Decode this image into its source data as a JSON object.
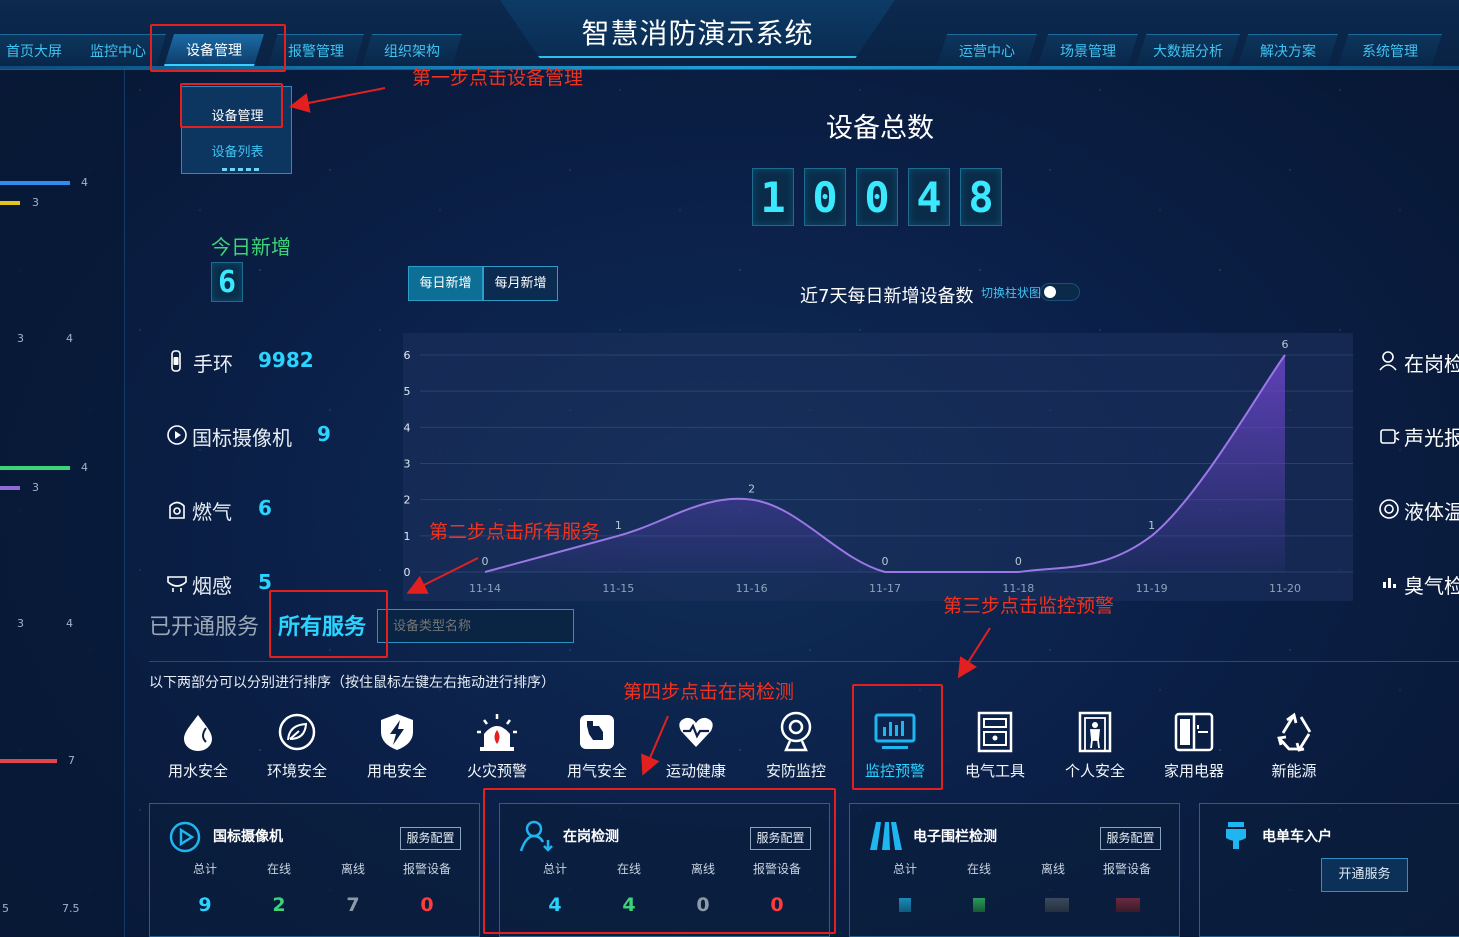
{
  "header": {
    "title": "智慧消防演示系统",
    "nav_left": [
      "首页大屏",
      "监控中心",
      "设备管理",
      "报警管理",
      "组织架构"
    ],
    "nav_right": [
      "运营中心",
      "场景管理",
      "大数据分析",
      "解决方案",
      "系统管理"
    ],
    "active": "设备管理"
  },
  "dropdown": {
    "items": [
      "设备管理",
      "设备列表"
    ]
  },
  "left_rail": {
    "nums": [
      "4",
      "3",
      "3",
      "4",
      "4",
      "3",
      "3",
      "4",
      "7",
      "5",
      "7.5"
    ],
    "bars": [
      {
        "color": "#2f8df2",
        "value": 4
      },
      {
        "color": "#e6c21c",
        "value": 3
      },
      {
        "color": "#3ed27a",
        "value": 4
      },
      {
        "color": "#8f6ad8",
        "value": 3
      },
      {
        "color": "#e0474d",
        "value": 7
      }
    ]
  },
  "summary": {
    "total_label": "设备总数",
    "total_digits": [
      "1",
      "0",
      "0",
      "4",
      "8"
    ],
    "today_label": "今日新增",
    "today_value": "6"
  },
  "devices": [
    {
      "label": "手环",
      "value": "9982"
    },
    {
      "label": "国标摄像机",
      "value": "9"
    },
    {
      "label": "燃气",
      "value": "6"
    },
    {
      "label": "烟感",
      "value": "5"
    }
  ],
  "chart_tabs": {
    "daily": "每日新增",
    "monthly": "每月新增"
  },
  "chart_title": "近7天每日新增设备数",
  "toggle_label": "切换柱状图",
  "chart_data": {
    "type": "area",
    "categories": [
      "11-14",
      "11-15",
      "11-16",
      "11-17",
      "11-18",
      "11-19",
      "11-20"
    ],
    "values": [
      0,
      1,
      2,
      0,
      0,
      1,
      6
    ],
    "ylim": [
      0,
      6
    ],
    "yticks": [
      0,
      1,
      2,
      3,
      4,
      5,
      6
    ],
    "title": "近7天每日新增设备数",
    "xlabel": "",
    "ylabel": "",
    "color": "#8f6ad8"
  },
  "right_labels": [
    "在岗检",
    "声光报",
    "液体温",
    "臭气检"
  ],
  "services": {
    "opened_tab": "已开通服务",
    "all_tab": "所有服务",
    "search_placeholder": "设备类型名称",
    "hint": "以下两部分可以分别进行排序（按住鼠标左键左右拖动进行排序）",
    "categories": [
      {
        "label": "用水安全",
        "icon": "water-drop-icon"
      },
      {
        "label": "环境安全",
        "icon": "leaf-icon"
      },
      {
        "label": "用电安全",
        "icon": "lightning-shield-icon"
      },
      {
        "label": "火灾预警",
        "icon": "alarm-siren-icon"
      },
      {
        "label": "用气安全",
        "icon": "gas-icon"
      },
      {
        "label": "运动健康",
        "icon": "heart-pulse-icon"
      },
      {
        "label": "安防监控",
        "icon": "webcam-icon"
      },
      {
        "label": "监控预警",
        "icon": "monitor-chart-icon"
      },
      {
        "label": "电气工具",
        "icon": "cabinet-icon"
      },
      {
        "label": "个人安全",
        "icon": "person-gate-icon"
      },
      {
        "label": "家用电器",
        "icon": "fridge-icon"
      },
      {
        "label": "新能源",
        "icon": "recycle-icon"
      }
    ]
  },
  "cards": [
    {
      "title": "国标摄像机",
      "config": "服务配置",
      "cols": [
        "总计",
        "在线",
        "离线",
        "报警设备"
      ],
      "values": [
        "9",
        "2",
        "7",
        "0"
      ],
      "icon": "play-circle-icon"
    },
    {
      "title": "在岗检测",
      "config": "服务配置",
      "cols": [
        "总计",
        "在线",
        "离线",
        "报警设备"
      ],
      "values": [
        "4",
        "4",
        "0",
        "0"
      ],
      "icon": "person-check-icon"
    },
    {
      "title": "电子围栏检测",
      "config": "服务配置",
      "cols": [
        "总计",
        "在线",
        "离线",
        "报警设备"
      ],
      "icon": "fence-icon"
    },
    {
      "title": "电单车入户",
      "action": "开通服务",
      "icon": "ebike-icon"
    }
  ],
  "annotations": {
    "step1": "第一步点击设备管理",
    "step2": "第二步点击所有服务",
    "step3": "第三步点击监控预警",
    "step4": "第四步点击在岗检测"
  },
  "colors": {
    "accent": "#2ad4ff",
    "annotation": "#e3201f",
    "green": "#3ed27a",
    "red": "#ff3b3b",
    "gray": "#8e9aa6"
  }
}
